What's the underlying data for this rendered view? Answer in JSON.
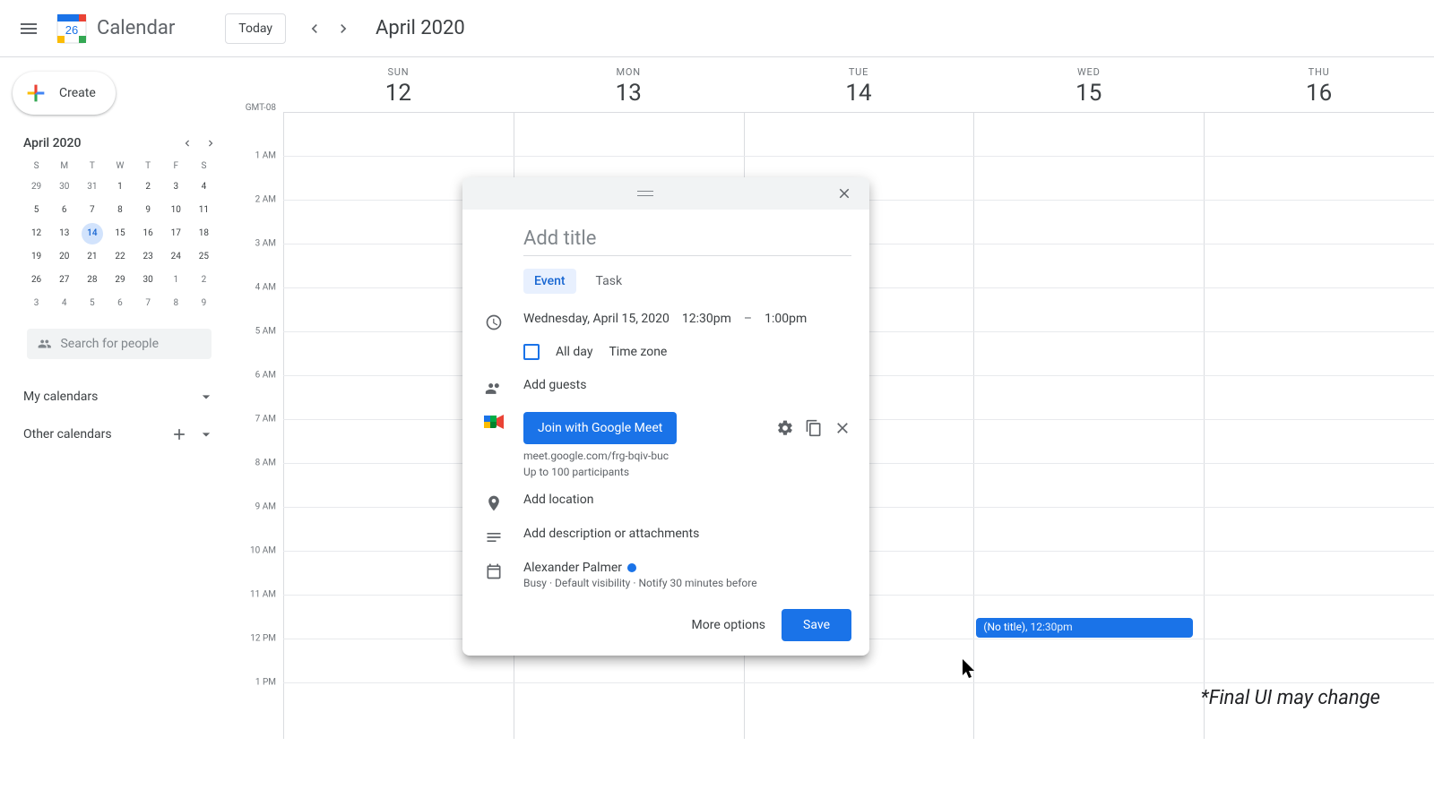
{
  "header": {
    "app_name": "Calendar",
    "logo_day": "26",
    "today_label": "Today",
    "month_label": "April 2020"
  },
  "sidebar": {
    "create_label": "Create",
    "mini_cal_month": "April 2020",
    "dow": [
      "S",
      "M",
      "T",
      "W",
      "T",
      "F",
      "S"
    ],
    "weeks": [
      [
        {
          "n": "29",
          "dim": true
        },
        {
          "n": "30",
          "dim": true
        },
        {
          "n": "31",
          "dim": true
        },
        {
          "n": "1"
        },
        {
          "n": "2"
        },
        {
          "n": "3"
        },
        {
          "n": "4"
        }
      ],
      [
        {
          "n": "5"
        },
        {
          "n": "6"
        },
        {
          "n": "7"
        },
        {
          "n": "8"
        },
        {
          "n": "9"
        },
        {
          "n": "10"
        },
        {
          "n": "11"
        }
      ],
      [
        {
          "n": "12"
        },
        {
          "n": "13"
        },
        {
          "n": "14",
          "today": true
        },
        {
          "n": "15"
        },
        {
          "n": "16"
        },
        {
          "n": "17"
        },
        {
          "n": "18"
        }
      ],
      [
        {
          "n": "19"
        },
        {
          "n": "20"
        },
        {
          "n": "21"
        },
        {
          "n": "22"
        },
        {
          "n": "23"
        },
        {
          "n": "24"
        },
        {
          "n": "25"
        }
      ],
      [
        {
          "n": "26"
        },
        {
          "n": "27"
        },
        {
          "n": "28"
        },
        {
          "n": "29"
        },
        {
          "n": "30"
        },
        {
          "n": "1",
          "dim": true
        },
        {
          "n": "2",
          "dim": true
        }
      ],
      [
        {
          "n": "3",
          "dim": true
        },
        {
          "n": "4",
          "dim": true
        },
        {
          "n": "5",
          "dim": true
        },
        {
          "n": "6",
          "dim": true
        },
        {
          "n": "7",
          "dim": true
        },
        {
          "n": "8",
          "dim": true
        },
        {
          "n": "9",
          "dim": true
        }
      ]
    ],
    "search_placeholder": "Search for people",
    "my_calendars": "My calendars",
    "other_calendars": "Other calendars"
  },
  "grid": {
    "timezone": "GMT-08",
    "days": [
      {
        "dow": "SUN",
        "num": "12"
      },
      {
        "dow": "MON",
        "num": "13"
      },
      {
        "dow": "TUE",
        "num": "14"
      },
      {
        "dow": "WED",
        "num": "15"
      },
      {
        "dow": "THU",
        "num": "16"
      }
    ],
    "hours": [
      "1 AM",
      "2 AM",
      "3 AM",
      "4 AM",
      "5 AM",
      "6 AM",
      "7 AM",
      "8 AM",
      "9 AM",
      "10 AM",
      "11 AM",
      "12 PM",
      "1 PM"
    ],
    "event": {
      "title": "(No title)",
      "time": "12:30pm"
    }
  },
  "dialog": {
    "title_placeholder": "Add title",
    "tab_event": "Event",
    "tab_task": "Task",
    "date_text": "Wednesday, April 15, 2020",
    "start_time": "12:30pm",
    "end_time": "1:00pm",
    "all_day": "All day",
    "time_zone": "Time zone",
    "add_guests": "Add guests",
    "meet_button": "Join with Google Meet",
    "meet_url": "meet.google.com/frg-bqiv-buc",
    "meet_participants": "Up to 100 participants",
    "add_location": "Add location",
    "add_description": "Add description or attachments",
    "organizer_name": "Alexander Palmer",
    "organizer_sub": "Busy · Default visibility · Notify 30 minutes before",
    "more_options": "More options",
    "save": "Save"
  },
  "disclaimer": "*Final UI may change"
}
